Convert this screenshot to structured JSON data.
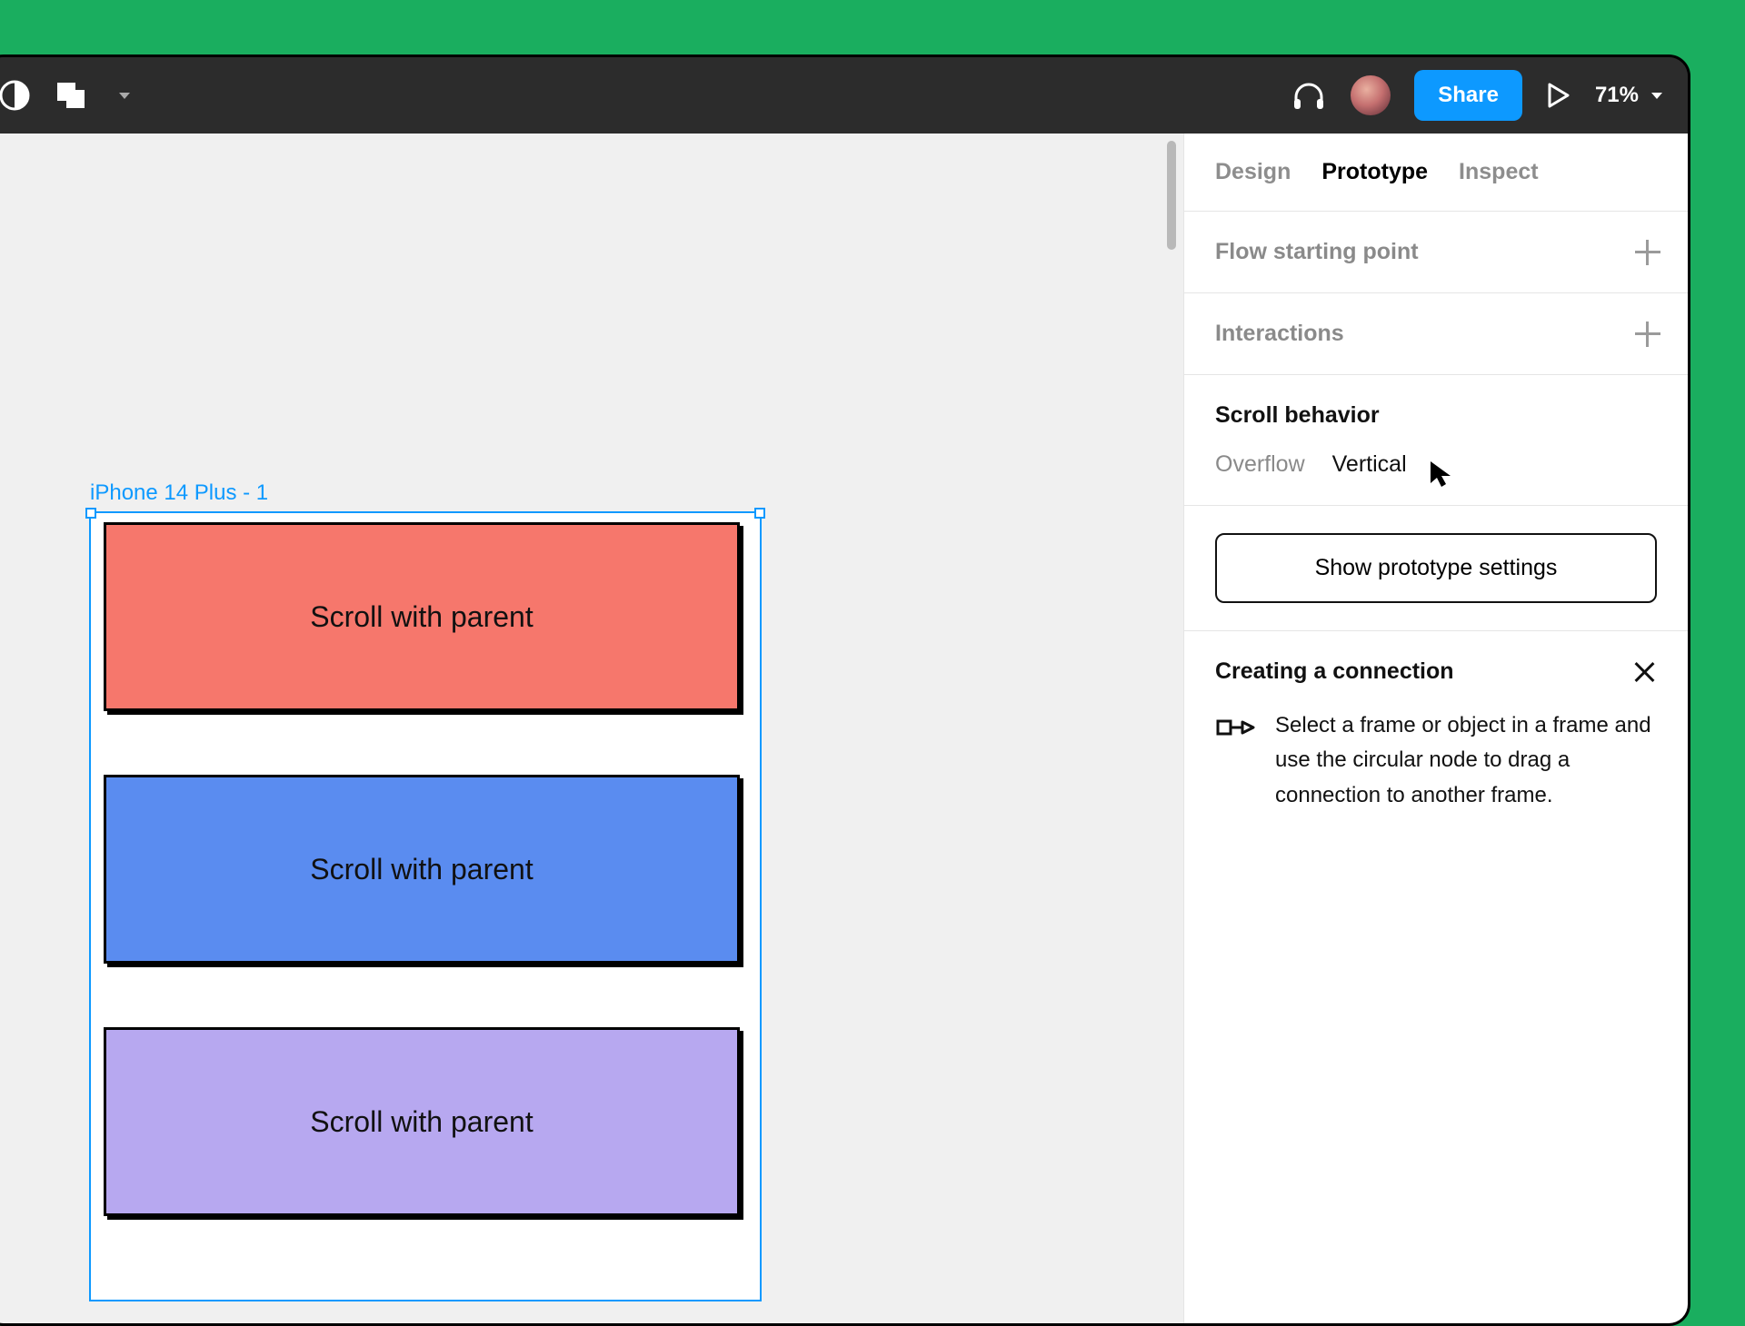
{
  "toolbar": {
    "share_label": "Share",
    "zoom_value": "71%"
  },
  "canvas": {
    "frame_label": "iPhone 14 Plus - 1",
    "blocks": [
      {
        "label": "Scroll with parent"
      },
      {
        "label": "Scroll with parent"
      },
      {
        "label": "Scroll with parent"
      }
    ]
  },
  "panel": {
    "tabs": {
      "design": "Design",
      "prototype": "Prototype",
      "inspect": "Inspect"
    },
    "flow_starting_point": "Flow starting point",
    "interactions": "Interactions",
    "scroll_behavior": {
      "title": "Scroll behavior",
      "overflow_label": "Overflow",
      "overflow_value": "Vertical"
    },
    "show_settings_label": "Show prototype settings",
    "tip": {
      "title": "Creating a connection",
      "body": "Select a frame or object in a frame and use the circular node to drag a connection to another frame."
    }
  }
}
